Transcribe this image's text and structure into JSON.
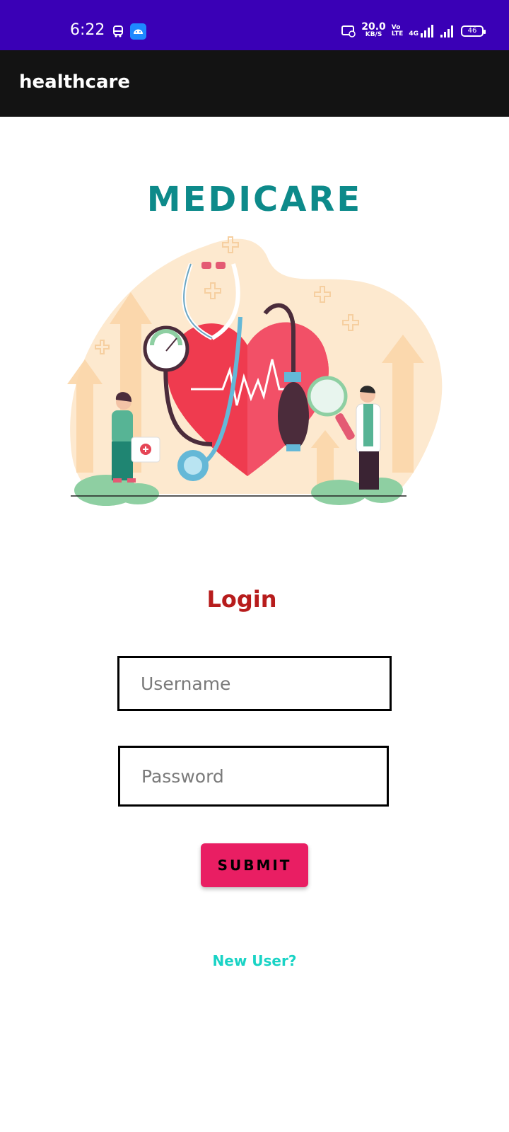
{
  "status_bar": {
    "time": "6:22",
    "speed_value": "20.0",
    "speed_unit": "KB/S",
    "volte": "Vo\nLTE",
    "network": "4G",
    "battery": "46"
  },
  "app_bar": {
    "title": "healthcare"
  },
  "brand": {
    "title": "MEDICARE"
  },
  "login": {
    "title": "Login",
    "username_placeholder": "Username",
    "password_placeholder": "Password",
    "submit_label": "SUBMIT",
    "new_user_link": "New User?"
  },
  "colors": {
    "status_bar": "#3a00b6",
    "app_bar": "#131313",
    "brand": "#0d8a8a",
    "login_title": "#b71c1c",
    "submit": "#e91e63",
    "link": "#19d3c5"
  }
}
